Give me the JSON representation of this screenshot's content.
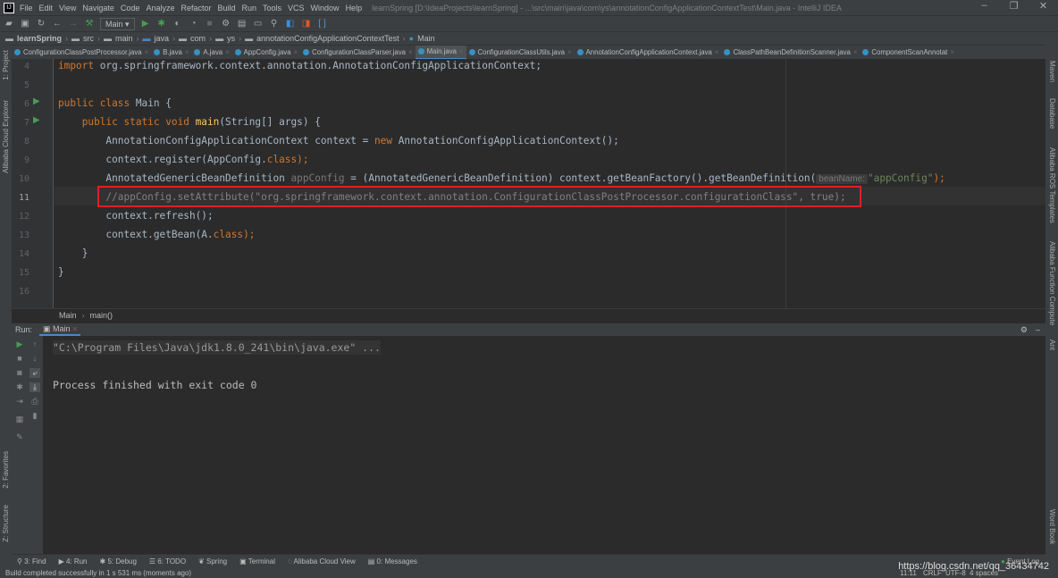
{
  "titlebar": {
    "menu": [
      "File",
      "Edit",
      "View",
      "Navigate",
      "Code",
      "Analyze",
      "Refactor",
      "Build",
      "Run",
      "Tools",
      "VCS",
      "Window",
      "Help"
    ],
    "title": "learnSpring [D:\\IdeaProjects\\learnSpring] - ...\\src\\main\\java\\com\\ys\\annotationConfigApplicationContextTest\\Main.java - IntelliJ IDEA"
  },
  "toolbar": {
    "run_config": "Main"
  },
  "breadcrumb": [
    "learnSpring",
    "src",
    "main",
    "java",
    "com",
    "ys",
    "annotationConfigApplicationContextTest",
    "Main"
  ],
  "tabs": [
    "ConfigurationClassPostProcessor.java",
    "B.java",
    "A.java",
    "AppConfig.java",
    "ConfigurationClassParser.java",
    "Main.java",
    "ConfigurationClassUtils.java",
    "AnnotationConfigApplicationContext.java",
    "ClassPathBeanDefinitionScanner.java",
    "ComponentScanAnnotat"
  ],
  "active_tab": "Main.java",
  "left_strip": [
    "1: Project",
    "Alibaba Cloud Explorer",
    "2: Favorites",
    "Z: Structure"
  ],
  "right_strip": [
    "Maven",
    "Database",
    "Alibaba ROS Templates",
    "Alibaba Function Compute",
    "Ant",
    "Word Book"
  ],
  "editor": {
    "line_numbers": [
      "4",
      "5",
      "6",
      "7",
      "8",
      "9",
      "10",
      "11",
      "12",
      "13",
      "14",
      "15",
      "16"
    ],
    "lines": {
      "l4a": "import",
      "l4b": " org.springframework.context.annotation.AnnotationConfigApplicationContext;",
      "l6a": "public class",
      "l6b": " Main {",
      "l7a": "    public static void ",
      "l7b": "main",
      "l7c": "(String[] args) {",
      "l8a": "        AnnotationConfigApplicationContext context = ",
      "l8b": "new",
      "l8c": " AnnotationConfigApplicationContext();",
      "l9a": "        context.register(AppConfig.",
      "l9b": "class",
      "l9c": ");",
      "l10a": "        AnnotatedGenericBeanDefinition ",
      "l10b": "appConfig",
      "l10c": " = (AnnotatedGenericBeanDefinition) context.getBeanFactory().getBeanDefinition(",
      "l10hint": "beanName:",
      "l10str": "\"appConfig\"",
      "l10d": ");",
      "l11": "        //appConfig.setAttribute(\"org.springframework.context.annotation.ConfigurationClassPostProcessor.configurationClass\", true);",
      "l12": "        context.refresh();",
      "l13a": "        context.getBean(A.",
      "l13b": "class",
      "l13c": ");",
      "l14": "    }",
      "l15": "}"
    },
    "breadcrumb": [
      "Main",
      "main()"
    ]
  },
  "run": {
    "label": "Run:",
    "tab": "Main",
    "console": [
      "\"C:\\Program Files\\Java\\jdk1.8.0_241\\bin\\java.exe\" ...",
      "Process finished with exit code 0"
    ]
  },
  "toolwindows": [
    "3: Find",
    "4: Run",
    "5: Debug",
    "6: TODO",
    "Spring",
    "Terminal",
    "Alibaba Cloud View",
    "0: Messages"
  ],
  "event_log": "Event Log",
  "status": {
    "message": "Build completed successfully in 1 s 531 ms (moments ago)",
    "position": "11:11",
    "line_sep": "CRLF",
    "encoding": "UTF-8",
    "indent": "4 spaces"
  },
  "watermark": "https://blog.csdn.net/qq_36434742",
  "colors": {
    "highlight_box": "#e02020",
    "keyword": "#cc7832",
    "string": "#6a8759",
    "comment": "#808080"
  }
}
